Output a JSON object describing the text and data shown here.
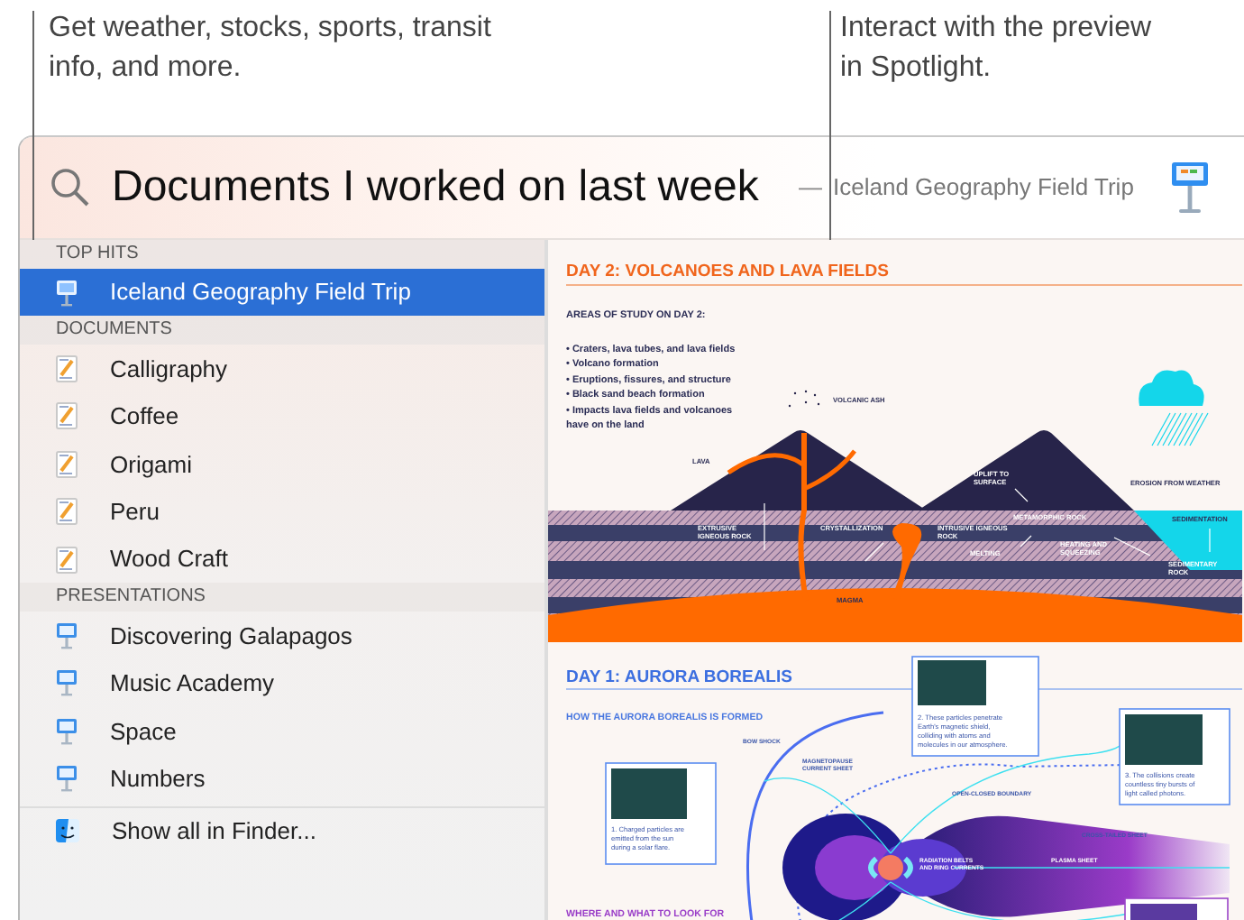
{
  "callouts": [
    {
      "text": "Get weather, stocks, sports, transit info, and more."
    },
    {
      "text": "Interact with the preview in Spotlight."
    }
  ],
  "search": {
    "query": "Documents I worked on last week",
    "separator": "—",
    "hint": "Iceland Geography Field Trip"
  },
  "sections": [
    {
      "title": "TOP HITS",
      "items": [
        {
          "label": "Iceland Geography Field Trip",
          "kind": "keynote",
          "selected": true
        }
      ]
    },
    {
      "title": "DOCUMENTS",
      "items": [
        {
          "label": "Calligraphy",
          "kind": "pages",
          "selected": false
        },
        {
          "label": "Coffee",
          "kind": "pages",
          "selected": false
        },
        {
          "label": "Origami",
          "kind": "pages",
          "selected": false
        },
        {
          "label": "Peru",
          "kind": "pages",
          "selected": false
        },
        {
          "label": "Wood Craft",
          "kind": "pages",
          "selected": false
        }
      ]
    },
    {
      "title": "PRESENTATIONS",
      "items": [
        {
          "label": "Discovering Galapagos",
          "kind": "keynote",
          "selected": false
        },
        {
          "label": "Music Academy",
          "kind": "keynote",
          "selected": false
        },
        {
          "label": "Space",
          "kind": "keynote",
          "selected": false
        },
        {
          "label": "Numbers",
          "kind": "keynote",
          "selected": false
        }
      ]
    }
  ],
  "show_all": {
    "label": "Show all in Finder..."
  },
  "preview": {
    "day2": {
      "title": "DAY 2: VOLCANOES AND LAVA FIELDS",
      "subtitle": "AREAS OF STUDY ON DAY 2:",
      "bullets": [
        {
          "lines": [
            "• Craters, lava tubes, and lava fields"
          ]
        },
        {
          "lines": [
            "• Volcano formation"
          ]
        },
        {
          "lines": [
            "• Eruptions, fissures, and structure"
          ]
        },
        {
          "lines": [
            "• Black sand beach formation"
          ]
        },
        {
          "lines": [
            "• Impacts lava fields and volcanoes",
            "have on the land"
          ]
        }
      ],
      "labels": [
        {
          "lines": [
            "VOLCANIC ASH"
          ]
        },
        {
          "lines": [
            "LAVA"
          ]
        },
        {
          "lines": [
            "UPLIFT TO",
            "SURFACE"
          ]
        },
        {
          "lines": [
            "EROSION FROM WEATHER"
          ]
        },
        {
          "lines": [
            "METAMORPHIC ROCK"
          ]
        },
        {
          "lines": [
            "SEDIMENTATION"
          ]
        },
        {
          "lines": [
            "EXTRUSIVE",
            "IGNEOUS ROCK"
          ]
        },
        {
          "lines": [
            "CRYSTALLIZATION"
          ]
        },
        {
          "lines": [
            "INTRUSIVE IGNEOUS",
            "ROCK"
          ]
        },
        {
          "lines": [
            "MELTING"
          ]
        },
        {
          "lines": [
            "HEATING AND",
            "SQUEEZING"
          ]
        },
        {
          "lines": [
            "SEDIMENTARY",
            "ROCK"
          ]
        },
        {
          "lines": [
            "MAGMA"
          ]
        }
      ]
    },
    "day1": {
      "title": "DAY 1: AURORA BOREALIS",
      "subtitle": "HOW THE AURORA BOREALIS IS FORMED",
      "captions": [
        {
          "lines": [
            "1. Charged particles are",
            "emitted from the sun",
            "during a solar flare."
          ]
        },
        {
          "lines": [
            "2. These particles penetrate",
            "Earth's magnetic shield,",
            "colliding with atoms and",
            "molecules in our atmosphere."
          ]
        },
        {
          "lines": [
            "3. The collisions create",
            "countless tiny bursts of",
            "light called photons."
          ]
        }
      ],
      "labels": [
        {
          "lines": [
            "BOW SHOCK"
          ]
        },
        {
          "lines": [
            "MAGNETOPAUSE",
            "CURRENT SHEET"
          ]
        },
        {
          "lines": [
            "OPEN-CLOSED BOUNDARY"
          ]
        },
        {
          "lines": [
            "CROSS-TAILED SHEET"
          ]
        },
        {
          "lines": [
            "PLASMA SHEET"
          ]
        },
        {
          "lines": [
            "RADIATION BELTS",
            "AND RING CURRENTS"
          ]
        }
      ],
      "footer": "WHERE AND WHAT TO LOOK FOR"
    }
  }
}
